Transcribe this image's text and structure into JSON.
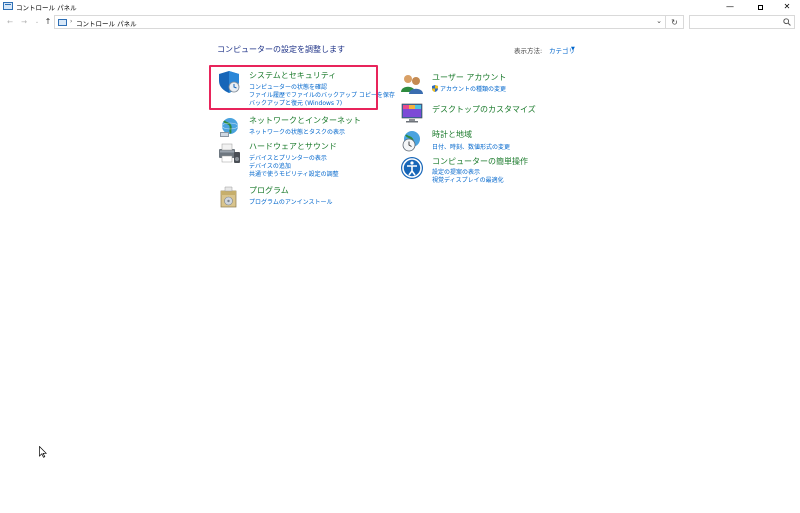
{
  "window": {
    "title": "コントロール パネル",
    "min_glyph": "—",
    "close_glyph": "✕"
  },
  "nav": {
    "back_glyph": "←",
    "forward_glyph": "→",
    "recent_glyph": "⌄",
    "up_glyph": "↑",
    "breadcrumb_sep": "›",
    "address": "コントロール パネル",
    "dropdown_glyph": "⌄",
    "refresh_glyph": "↻",
    "search_placeholder": ""
  },
  "main": {
    "heading": "コンピューターの設定を調整します",
    "view_by_label": "表示方法:",
    "view_by_value": "カテゴリ",
    "view_by_arrow": "▼"
  },
  "left_categories": [
    {
      "title": "システムとセキュリティ",
      "links": [
        "コンピューターの状態を確認",
        "ファイル履歴でファイルのバックアップ コピーを保存",
        "バックアップと復元 (Windows 7)"
      ]
    },
    {
      "title": "ネットワークとインターネット",
      "links": [
        "ネットワークの状態とタスクの表示"
      ]
    },
    {
      "title": "ハードウェアとサウンド",
      "links": [
        "デバイスとプリンターの表示",
        "デバイスの追加",
        "共通で使うモビリティ設定の調整"
      ]
    },
    {
      "title": "プログラム",
      "links": [
        "プログラムのアンインストール"
      ]
    }
  ],
  "right_categories": [
    {
      "title": "ユーザー アカウント",
      "links": [
        "アカウントの種類の変更"
      ]
    },
    {
      "title": "デスクトップのカスタマイズ",
      "links": []
    },
    {
      "title": "時計と地域",
      "links": [
        "日付、時刻、数値形式の変更"
      ]
    },
    {
      "title": "コンピューターの簡単操作",
      "links": [
        "設定の提案の表示",
        "視覚ディスプレイの最適化"
      ]
    }
  ],
  "colors": {
    "highlight": "#e8245b",
    "category_title": "#1a7a2b",
    "link": "#0066cc",
    "heading": "#1e3287"
  }
}
